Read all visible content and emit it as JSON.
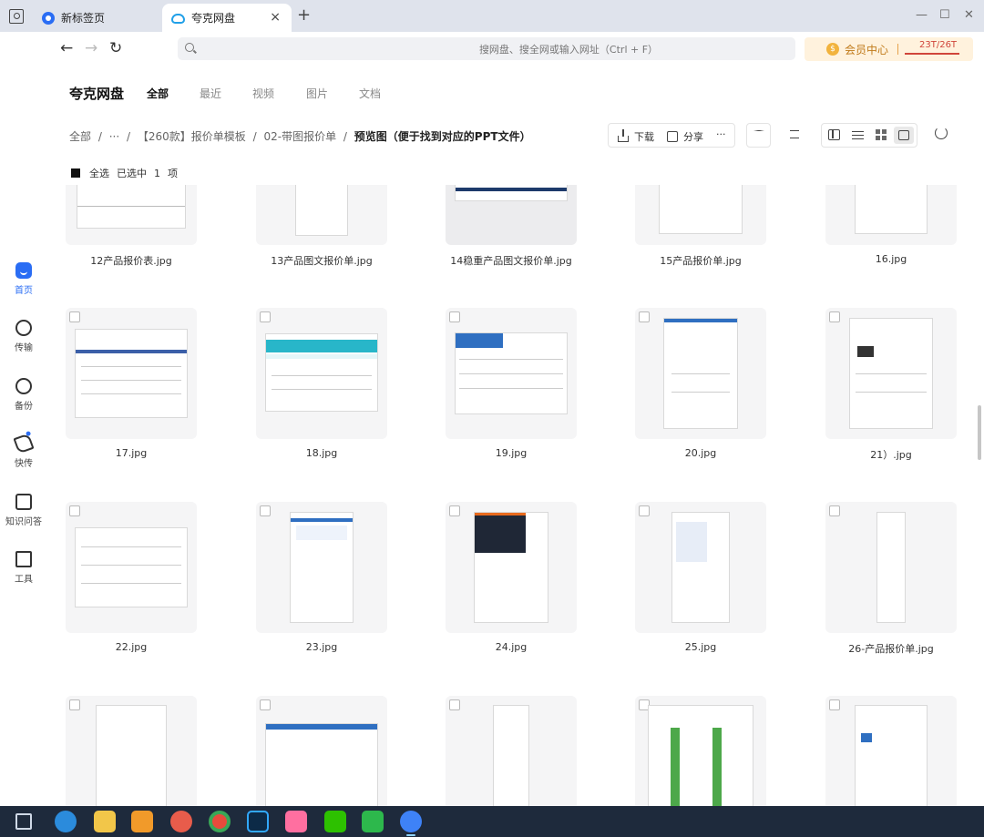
{
  "browser": {
    "tabs": [
      {
        "label": "新标签页"
      },
      {
        "label": "夸克网盘"
      }
    ],
    "new_tab": "+",
    "close_glyph": "×",
    "window_controls": [
      "—",
      "☐",
      "✕"
    ],
    "nav": {
      "back": "←",
      "forward": "→",
      "reload": "↻"
    },
    "search_placeholder": "搜网盘、搜全网或输入网址（Ctrl + F）",
    "vip": {
      "label": "会员中心",
      "coin": "$",
      "capacity": "23T/26T"
    }
  },
  "sidebar": {
    "items": [
      {
        "label": "首页",
        "icon": "home-icon",
        "active": true
      },
      {
        "label": "传输",
        "icon": "transfer-icon"
      },
      {
        "label": "备份",
        "icon": "backup-icon"
      },
      {
        "label": "快传",
        "icon": "quick-send-icon"
      },
      {
        "label": "知识问答",
        "icon": "qa-icon"
      },
      {
        "label": "工具",
        "icon": "tools-icon"
      }
    ]
  },
  "header": {
    "brand": "夸克网盘",
    "categories": [
      "全部",
      "最近",
      "视频",
      "图片",
      "文档"
    ],
    "active_category": "全部"
  },
  "breadcrumb": {
    "items": [
      "全部",
      "···",
      "【260款】报价单模板",
      "02-带图报价单",
      "预览图（便于找到对应的PPT文件）"
    ],
    "separator": "/"
  },
  "toolbar": {
    "download": "下载",
    "share": "分享",
    "more": "···"
  },
  "selection": {
    "select_all": "全选",
    "selected_prefix": "已选中",
    "count": "1",
    "unit": "项"
  },
  "files": [
    {
      "name": "12产品报价表.jpg"
    },
    {
      "name": "13产品图文报价单.jpg"
    },
    {
      "name": "14稳重产品图文报价单.jpg"
    },
    {
      "name": "15产品报价单.jpg"
    },
    {
      "name": "16.jpg"
    },
    {
      "name": "17.jpg"
    },
    {
      "name": "18.jpg"
    },
    {
      "name": "19.jpg"
    },
    {
      "name": "20.jpg"
    },
    {
      "name": "21）.jpg"
    },
    {
      "name": "22.jpg"
    },
    {
      "name": "23.jpg"
    },
    {
      "name": "24.jpg"
    },
    {
      "name": "25.jpg"
    },
    {
      "name": "26-产品报价单.jpg"
    },
    {
      "name": ""
    },
    {
      "name": ""
    },
    {
      "name": ""
    },
    {
      "name": ""
    },
    {
      "name": ""
    }
  ],
  "colors": {
    "accent": "#2a6df4",
    "taskbar": "#1e2a3c",
    "vip_bg": "#fff2dd",
    "vip_text": "#c07a1a",
    "capacity_text": "#d0453a"
  }
}
